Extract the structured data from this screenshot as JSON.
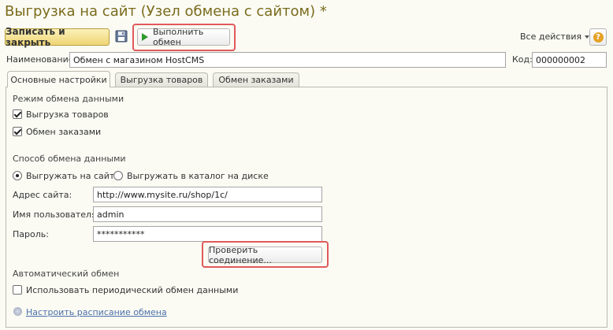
{
  "window": {
    "title": "Выгрузка на сайт (Узел обмена с сайтом) *"
  },
  "toolbar": {
    "save_close_label": "Записать и закрыть",
    "execute_label": "Выполнить обмен",
    "all_actions_label": "Все действия",
    "help_label": "?"
  },
  "header": {
    "name_label": "Наименование:",
    "name_value": "Обмен с магазином HostCMS",
    "code_label": "Код:",
    "code_value": "000000002"
  },
  "tabs": [
    {
      "label": "Основные настройки",
      "active": true
    },
    {
      "label": "Выгрузка товаров",
      "active": false
    },
    {
      "label": "Обмен заказами",
      "active": false
    }
  ],
  "exchange_mode": {
    "title": "Режим обмена данными",
    "items": [
      {
        "label": "Выгрузка товаров",
        "checked": true
      },
      {
        "label": "Обмен заказами",
        "checked": true
      }
    ]
  },
  "exchange_method": {
    "title": "Способ обмена данными",
    "options": [
      {
        "label": "Выгружать на сайт",
        "selected": true
      },
      {
        "label": "Выгружать в каталог на диске",
        "selected": false
      }
    ]
  },
  "connection": {
    "site_label": "Адрес сайта:",
    "site_value": "http://www.mysite.ru/shop/1c/",
    "user_label": "Имя пользователя:",
    "user_value": "admin",
    "password_label": "Пароль:",
    "password_value": "***********",
    "check_label": "Проверить соединение..."
  },
  "auto": {
    "title": "Автоматический обмен",
    "periodic_label": "Использовать периодический обмен данными",
    "periodic_checked": false,
    "schedule_link": "Настроить расписание обмена"
  },
  "colors": {
    "title": "#7a6b1c",
    "highlight": "#e05a5a",
    "link": "#4a6fa8",
    "primary_button": "#eed574"
  }
}
